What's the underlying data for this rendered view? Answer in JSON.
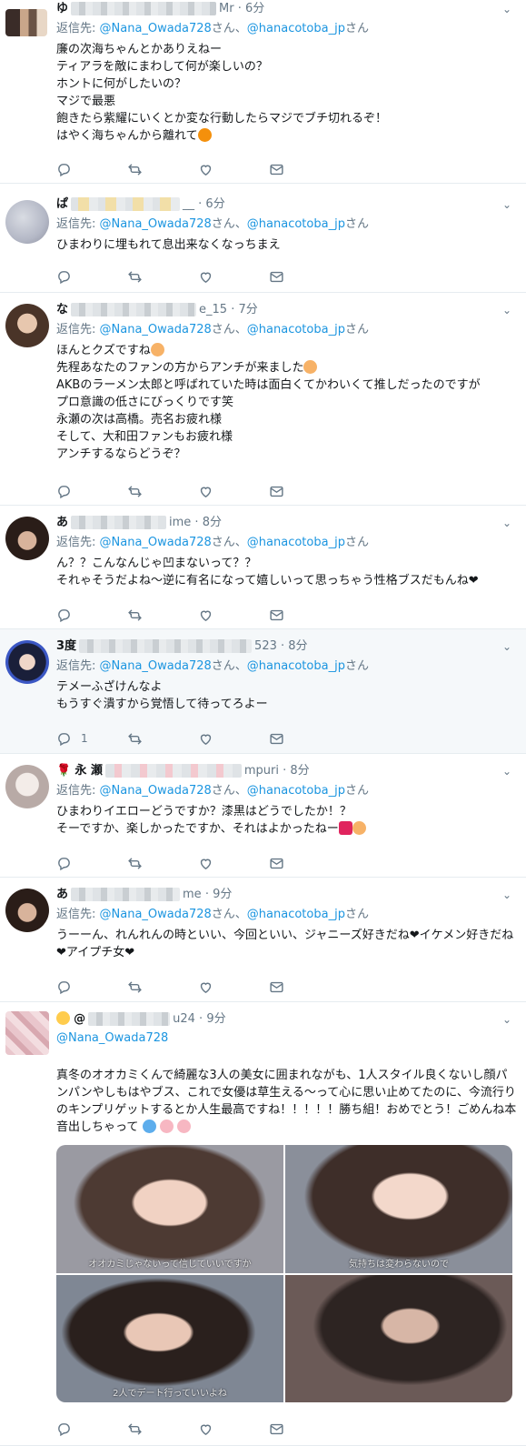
{
  "reply_prefix": "返信先: ",
  "reply_joiner": "さん、",
  "reply_suffix": "さん",
  "colors": {
    "link": "#1b95e0",
    "muted": "#657786",
    "divider": "#e6ecf0",
    "highlight_bg": "#f5f8fa",
    "text": "#14171a"
  },
  "tweets": [
    {
      "name_start": "ゆ",
      "handle_end": "Mr",
      "time": "6分",
      "reply_to": [
        "@Nana_Owada728",
        "@hanacotoba_jp"
      ],
      "text": "廉の次海ちゃんとかありえねー\nティアラを敵にまわして何が楽しいの？\nホントに何がしたいの？\nマジで最悪\n飽きたら紫耀にいくとか変な行動したらマジでブチ切れるぞ！\nはやく海ちゃんから離れて",
      "text_emoji": "angry-face-icon",
      "reply_count": ""
    },
    {
      "name_start": "ぱ",
      "handle_end": "__",
      "time": "6分",
      "reply_to": [
        "@Nana_Owada728",
        "@hanacotoba_jp"
      ],
      "text": "ひまわりに埋もれて息出来なくなっちまえ",
      "reply_count": ""
    },
    {
      "name_start": "な",
      "handle_end": "e_15",
      "time": "7分",
      "reply_to": [
        "@Nana_Owada728",
        "@hanacotoba_jp"
      ],
      "line1": "ほんとクズですね",
      "line2": "先程あなたのファンの方からアンチが来ました",
      "rest": "AKBのラーメン太郎と呼ばれていた時は面白くてかわいくて推しだったのですが\nプロ意識の低さにびっくりです笑\n永瀬の次は高橋。売名お疲れ様\nそして、大和田ファンもお疲れ様\nアンチするならどうぞ？",
      "reply_count": ""
    },
    {
      "name_start": "あ",
      "handle_end": "ime",
      "time": "8分",
      "reply_to": [
        "@Nana_Owada728",
        "@hanacotoba_jp"
      ],
      "text": "ん？？こんなんじゃ凹まないって？？\nそれゃそうだよね〜逆に有名になって嬉しいって思っちゃう性格ブスだもんね❤",
      "reply_count": ""
    },
    {
      "name_start": "3度",
      "handle_end": "523",
      "time": "8分",
      "reply_to": [
        "@Nana_Owada728",
        "@hanacotoba_jp"
      ],
      "text": "テメーふざけんなよ\nもうすぐ潰すから覚悟して待ってろよー",
      "reply_count": "1"
    },
    {
      "name_prefix": "🌹",
      "name_start": "永 瀬",
      "handle_end": "mpuri",
      "time": "8分",
      "reply_to": [
        "@Nana_Owada728",
        "@hanacotoba_jp"
      ],
      "text": "ひまわりイエローどうですか？漆黒はどうでしたか！？\nそーですか、楽しかったですか、それはよかったねー",
      "text_emoji": "anger-smile-icons",
      "reply_count": ""
    },
    {
      "name_start": "あ",
      "handle_end": "me",
      "time": "9分",
      "reply_to": [
        "@Nana_Owada728",
        "@hanacotoba_jp"
      ],
      "text": "うーーん、れんれんの時といい、今回といい、ジャニーズ好きだね❤イケメン好きだね❤アイプチ女❤",
      "reply_count": ""
    },
    {
      "name_prefix": "😇",
      "name_start": "@",
      "handle_end": "u24",
      "time": "9分",
      "mention_line": "@Nana_Owada728",
      "text": "真冬のオオカミくんで綺麗な3人の美女に囲まれながも、1人スタイル良くないし顔パンパンやしもはやブス、これで女優は草生える〜って心に思い止めてたのに、今流行りのキンプリゲットするとか人生最高ですね！！！！！勝ち組！おめでとう！ごめんね本音出しちゃって",
      "text_emoji": "droplet-flower-icons",
      "captions": [
        "オオカミじゃないって信じていいですか",
        "気持ちは変わらないので",
        "2人でデート行っていいよね",
        ""
      ],
      "reply_count": ""
    }
  ]
}
